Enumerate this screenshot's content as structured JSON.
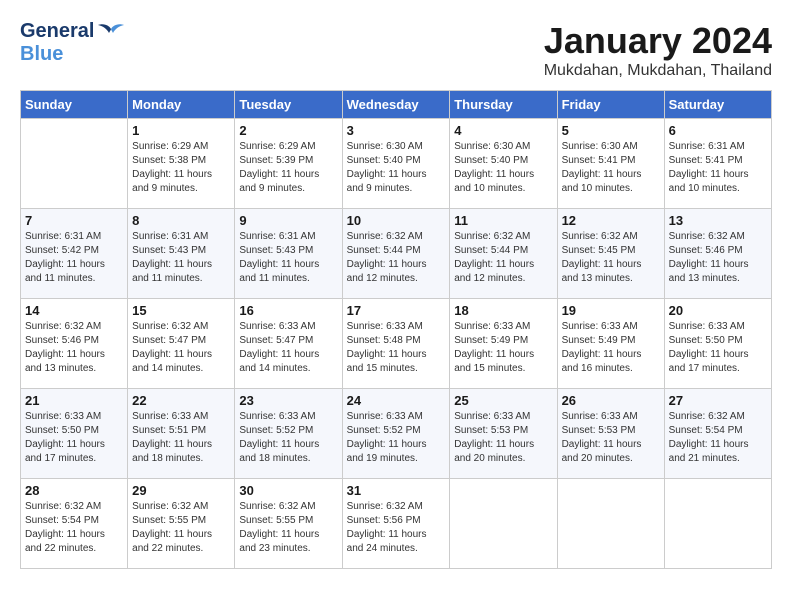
{
  "header": {
    "logo_general": "General",
    "logo_blue": "Blue",
    "month_title": "January 2024",
    "location": "Mukdahan, Mukdahan, Thailand"
  },
  "calendar": {
    "weekdays": [
      "Sunday",
      "Monday",
      "Tuesday",
      "Wednesday",
      "Thursday",
      "Friday",
      "Saturday"
    ],
    "weeks": [
      [
        {
          "day": "",
          "info": ""
        },
        {
          "day": "1",
          "info": "Sunrise: 6:29 AM\nSunset: 5:38 PM\nDaylight: 11 hours\nand 9 minutes."
        },
        {
          "day": "2",
          "info": "Sunrise: 6:29 AM\nSunset: 5:39 PM\nDaylight: 11 hours\nand 9 minutes."
        },
        {
          "day": "3",
          "info": "Sunrise: 6:30 AM\nSunset: 5:40 PM\nDaylight: 11 hours\nand 9 minutes."
        },
        {
          "day": "4",
          "info": "Sunrise: 6:30 AM\nSunset: 5:40 PM\nDaylight: 11 hours\nand 10 minutes."
        },
        {
          "day": "5",
          "info": "Sunrise: 6:30 AM\nSunset: 5:41 PM\nDaylight: 11 hours\nand 10 minutes."
        },
        {
          "day": "6",
          "info": "Sunrise: 6:31 AM\nSunset: 5:41 PM\nDaylight: 11 hours\nand 10 minutes."
        }
      ],
      [
        {
          "day": "7",
          "info": "Sunrise: 6:31 AM\nSunset: 5:42 PM\nDaylight: 11 hours\nand 11 minutes."
        },
        {
          "day": "8",
          "info": "Sunrise: 6:31 AM\nSunset: 5:43 PM\nDaylight: 11 hours\nand 11 minutes."
        },
        {
          "day": "9",
          "info": "Sunrise: 6:31 AM\nSunset: 5:43 PM\nDaylight: 11 hours\nand 11 minutes."
        },
        {
          "day": "10",
          "info": "Sunrise: 6:32 AM\nSunset: 5:44 PM\nDaylight: 11 hours\nand 12 minutes."
        },
        {
          "day": "11",
          "info": "Sunrise: 6:32 AM\nSunset: 5:44 PM\nDaylight: 11 hours\nand 12 minutes."
        },
        {
          "day": "12",
          "info": "Sunrise: 6:32 AM\nSunset: 5:45 PM\nDaylight: 11 hours\nand 13 minutes."
        },
        {
          "day": "13",
          "info": "Sunrise: 6:32 AM\nSunset: 5:46 PM\nDaylight: 11 hours\nand 13 minutes."
        }
      ],
      [
        {
          "day": "14",
          "info": "Sunrise: 6:32 AM\nSunset: 5:46 PM\nDaylight: 11 hours\nand 13 minutes."
        },
        {
          "day": "15",
          "info": "Sunrise: 6:32 AM\nSunset: 5:47 PM\nDaylight: 11 hours\nand 14 minutes."
        },
        {
          "day": "16",
          "info": "Sunrise: 6:33 AM\nSunset: 5:47 PM\nDaylight: 11 hours\nand 14 minutes."
        },
        {
          "day": "17",
          "info": "Sunrise: 6:33 AM\nSunset: 5:48 PM\nDaylight: 11 hours\nand 15 minutes."
        },
        {
          "day": "18",
          "info": "Sunrise: 6:33 AM\nSunset: 5:49 PM\nDaylight: 11 hours\nand 15 minutes."
        },
        {
          "day": "19",
          "info": "Sunrise: 6:33 AM\nSunset: 5:49 PM\nDaylight: 11 hours\nand 16 minutes."
        },
        {
          "day": "20",
          "info": "Sunrise: 6:33 AM\nSunset: 5:50 PM\nDaylight: 11 hours\nand 17 minutes."
        }
      ],
      [
        {
          "day": "21",
          "info": "Sunrise: 6:33 AM\nSunset: 5:50 PM\nDaylight: 11 hours\nand 17 minutes."
        },
        {
          "day": "22",
          "info": "Sunrise: 6:33 AM\nSunset: 5:51 PM\nDaylight: 11 hours\nand 18 minutes."
        },
        {
          "day": "23",
          "info": "Sunrise: 6:33 AM\nSunset: 5:52 PM\nDaylight: 11 hours\nand 18 minutes."
        },
        {
          "day": "24",
          "info": "Sunrise: 6:33 AM\nSunset: 5:52 PM\nDaylight: 11 hours\nand 19 minutes."
        },
        {
          "day": "25",
          "info": "Sunrise: 6:33 AM\nSunset: 5:53 PM\nDaylight: 11 hours\nand 20 minutes."
        },
        {
          "day": "26",
          "info": "Sunrise: 6:33 AM\nSunset: 5:53 PM\nDaylight: 11 hours\nand 20 minutes."
        },
        {
          "day": "27",
          "info": "Sunrise: 6:32 AM\nSunset: 5:54 PM\nDaylight: 11 hours\nand 21 minutes."
        }
      ],
      [
        {
          "day": "28",
          "info": "Sunrise: 6:32 AM\nSunset: 5:54 PM\nDaylight: 11 hours\nand 22 minutes."
        },
        {
          "day": "29",
          "info": "Sunrise: 6:32 AM\nSunset: 5:55 PM\nDaylight: 11 hours\nand 22 minutes."
        },
        {
          "day": "30",
          "info": "Sunrise: 6:32 AM\nSunset: 5:55 PM\nDaylight: 11 hours\nand 23 minutes."
        },
        {
          "day": "31",
          "info": "Sunrise: 6:32 AM\nSunset: 5:56 PM\nDaylight: 11 hours\nand 24 minutes."
        },
        {
          "day": "",
          "info": ""
        },
        {
          "day": "",
          "info": ""
        },
        {
          "day": "",
          "info": ""
        }
      ]
    ]
  }
}
